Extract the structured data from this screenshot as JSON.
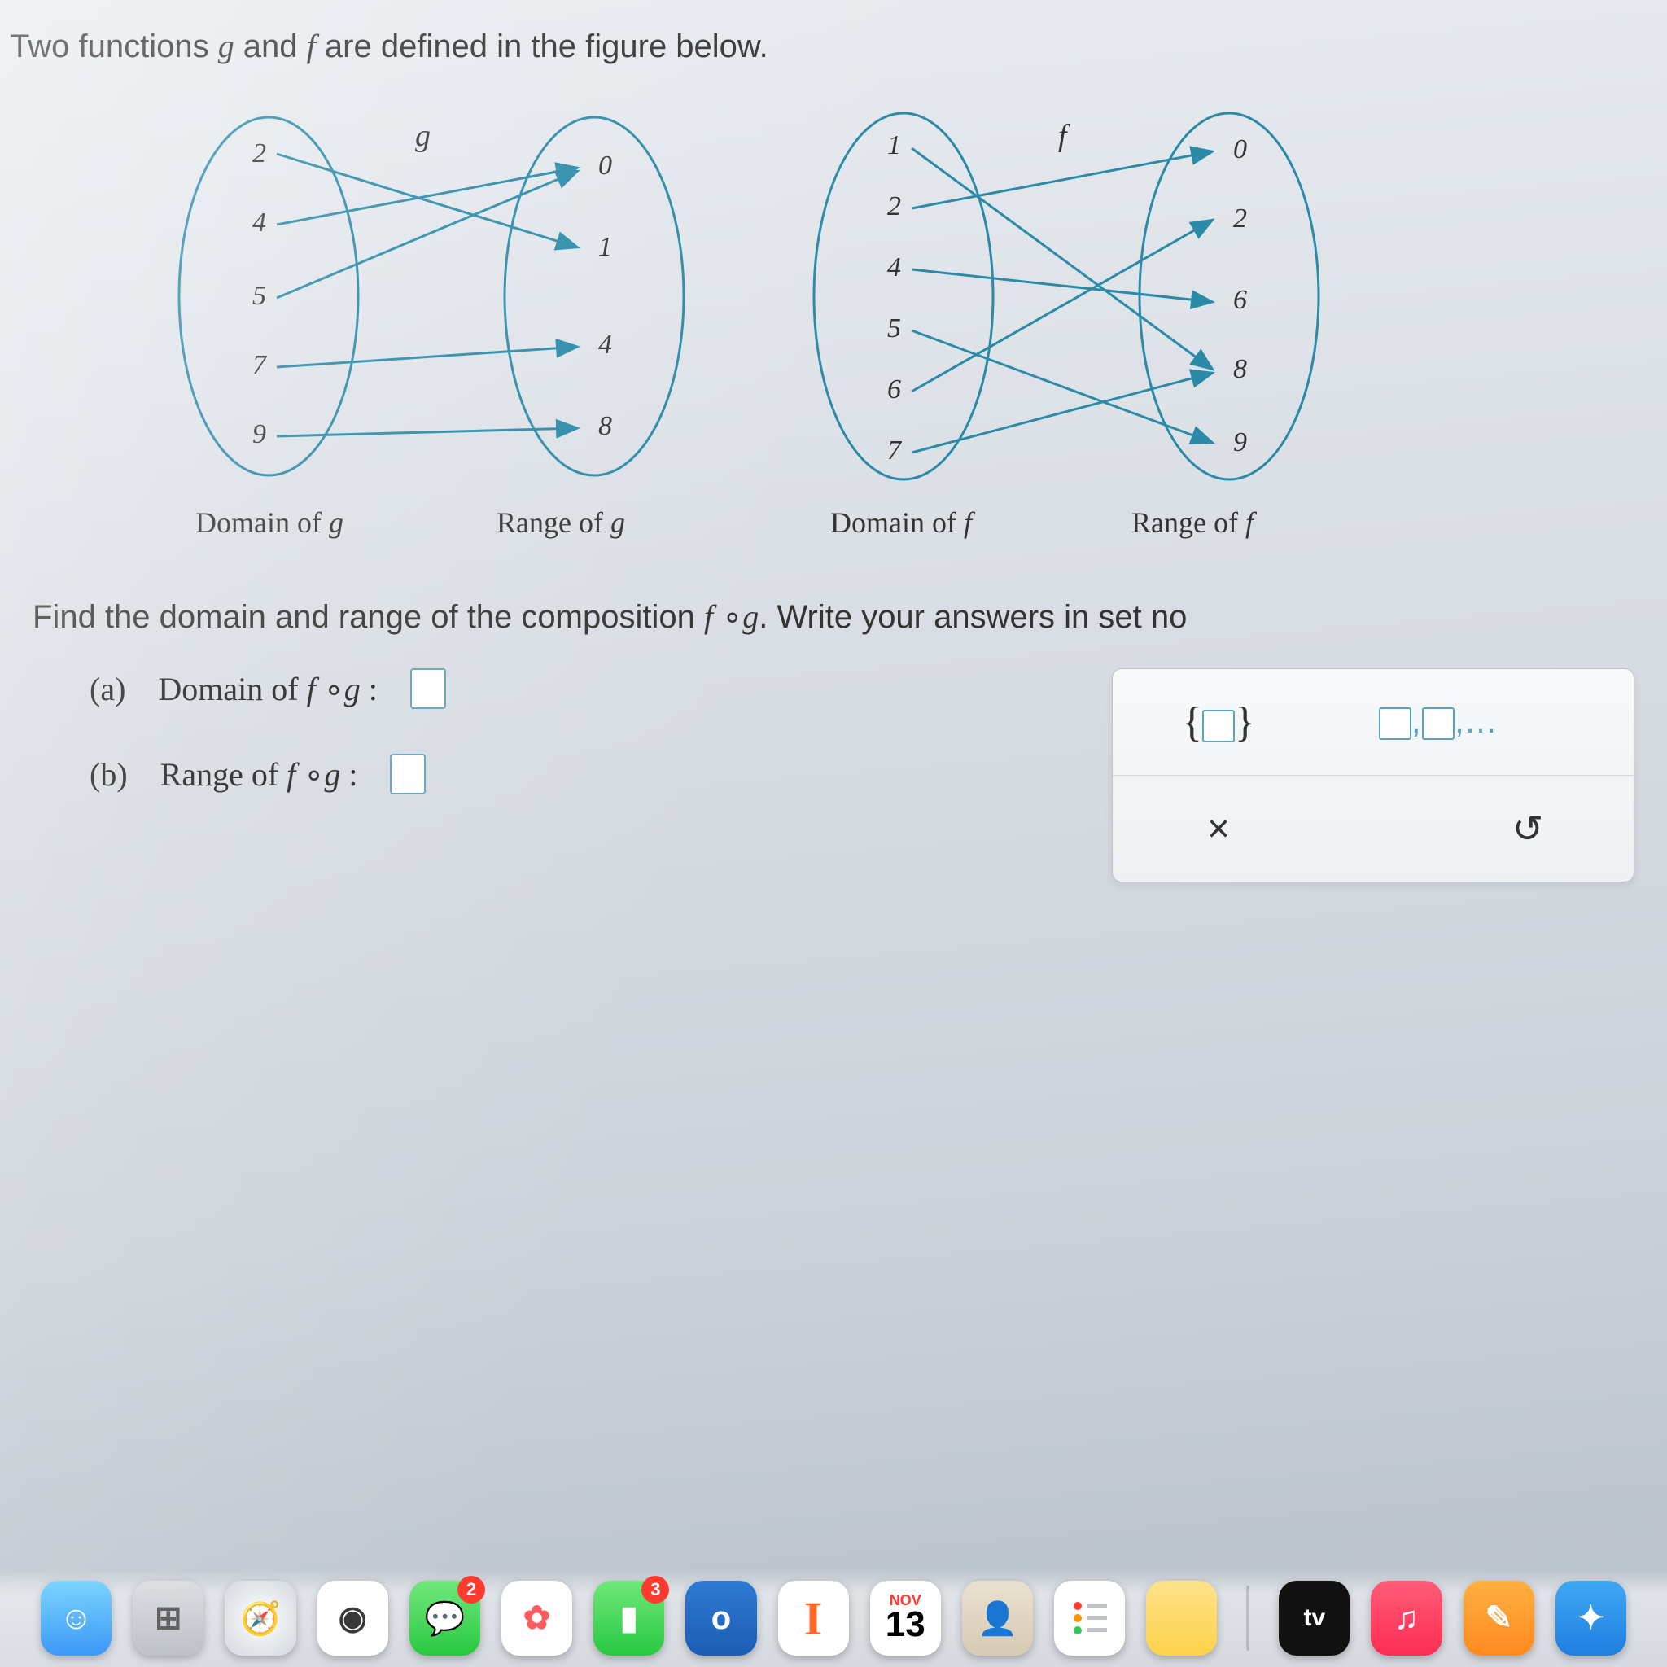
{
  "prompt": "Two functions g and f are defined in the figure below.",
  "subprompt": "Find the domain and range of the composition f ∘g. Write your answers in set no",
  "diagrams": {
    "g": {
      "label": "g",
      "domain_caption": "Domain of  g",
      "range_caption": "Range of  g",
      "domain": [
        "2",
        "4",
        "5",
        "7",
        "9"
      ],
      "range": [
        "0",
        "1",
        "4",
        "8"
      ],
      "mappings": [
        {
          "from": "2",
          "to": "1"
        },
        {
          "from": "4",
          "to": "0"
        },
        {
          "from": "5",
          "to": "0"
        },
        {
          "from": "7",
          "to": "4"
        },
        {
          "from": "9",
          "to": "8"
        }
      ]
    },
    "f": {
      "label": "f",
      "domain_caption": "Domain of  f",
      "range_caption": "Range of  f",
      "domain": [
        "1",
        "2",
        "4",
        "5",
        "6",
        "7"
      ],
      "range": [
        "0",
        "2",
        "6",
        "8",
        "9"
      ],
      "mappings": [
        {
          "from": "1",
          "to": "8"
        },
        {
          "from": "2",
          "to": "0"
        },
        {
          "from": "4",
          "to": "6"
        },
        {
          "from": "5",
          "to": "9"
        },
        {
          "from": "6",
          "to": "2"
        },
        {
          "from": "7",
          "to": "8"
        }
      ]
    }
  },
  "answers": {
    "a": {
      "tag": "(a)",
      "label": "Domain of f ∘g :"
    },
    "b": {
      "tag": "(b)",
      "label": "Range of f ∘g :"
    }
  },
  "palette": {
    "set_symbol": "{☐}",
    "list_symbol": "☐,☐,...",
    "clear": "×",
    "undo": "↺"
  },
  "dock": {
    "calendar": {
      "month": "NOV",
      "day": "13"
    },
    "apps": [
      {
        "name": "finder",
        "color": "linear-gradient(#6fd0ff,#2a8ff7)",
        "glyph": "☺"
      },
      {
        "name": "launchpad",
        "color": "linear-gradient(#d9dce0,#b9bec4)",
        "glyph": "⊞"
      },
      {
        "name": "safari",
        "color": "linear-gradient(#fff,#cfd6dc)",
        "glyph": "🧭"
      },
      {
        "name": "chrome",
        "color": "#fff",
        "glyph": "◉"
      },
      {
        "name": "messages",
        "color": "linear-gradient(#6fe87b,#28c840)",
        "glyph": "💬",
        "badge": "2"
      },
      {
        "name": "photos",
        "color": "#fff",
        "glyph": "✿"
      },
      {
        "name": "facetime",
        "color": "linear-gradient(#6fe87b,#28c840)",
        "glyph": "▮",
        "badge": "3"
      },
      {
        "name": "outlook",
        "color": "linear-gradient(#2e7ad4,#1b5db3)",
        "glyph": "✉"
      },
      {
        "name": "iwork",
        "color": "#fff",
        "glyph": "I",
        "textcolor": "#ff6a2b"
      },
      {
        "name": "calendar",
        "color": "#fff",
        "glyph": "cal"
      },
      {
        "name": "contacts",
        "color": "linear-gradient(#e9e0cf,#d6cbb4)",
        "glyph": "👤"
      },
      {
        "name": "reminders",
        "color": "#fff",
        "glyph": "≡"
      },
      {
        "name": "notes",
        "color": "linear-gradient(#ffe28a,#ffd24a)",
        "glyph": ""
      },
      {
        "name": "appletv",
        "color": "#111",
        "glyph": "tv"
      },
      {
        "name": "music",
        "color": "linear-gradient(#ff5b77,#ff2d55)",
        "glyph": "♫"
      },
      {
        "name": "drawing",
        "color": "linear-gradient(#ffb040,#ff8a20)",
        "glyph": "✎"
      },
      {
        "name": "extra",
        "color": "linear-gradient(#3ea8f4,#1f7fe0)",
        "glyph": "✦"
      }
    ]
  }
}
